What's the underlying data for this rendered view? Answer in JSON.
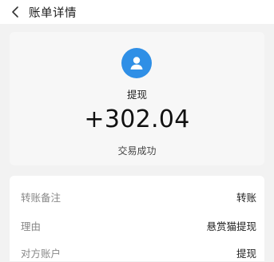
{
  "header": {
    "title": "账单详情",
    "back_icon": "chevron-left-icon"
  },
  "summary": {
    "avatar_icon": "user-icon",
    "avatar_color": "#2f8fe6",
    "title": "提现",
    "amount": "+302.04",
    "status": "交易成功"
  },
  "details": {
    "rows": [
      {
        "label": "转账备注",
        "value": "转账"
      },
      {
        "label": "理由",
        "value": "悬赏猫提现"
      },
      {
        "label": "对方账户",
        "value": "提现"
      }
    ]
  }
}
